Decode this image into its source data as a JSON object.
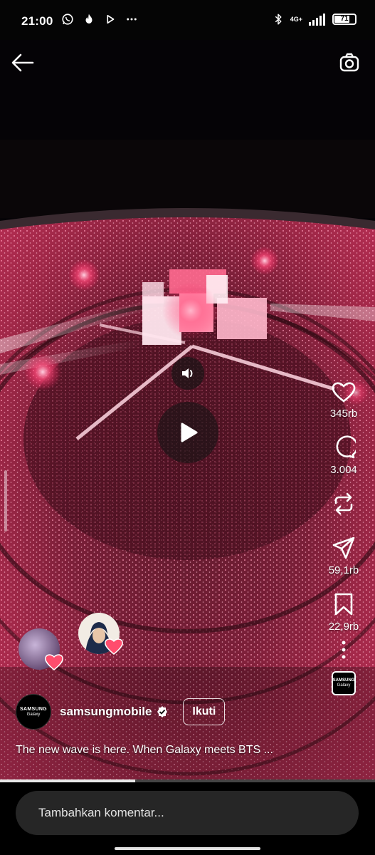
{
  "status_bar": {
    "time": "21:00",
    "network": "4G+",
    "battery": "71",
    "icons": [
      "whatsapp-icon",
      "tinder-icon",
      "play-icon",
      "more-dots-icon",
      "bluetooth-icon",
      "signal-icon",
      "battery-icon"
    ]
  },
  "video": {
    "description_icons": [
      "back-arrow-icon",
      "camera-icon",
      "speaker-icon",
      "play-icon"
    ],
    "progress": 0.36
  },
  "actions": {
    "like_count": "345rb",
    "comment_count": "3.004",
    "share_count": "59,1rb",
    "save_count": "22,9rb"
  },
  "audio": {
    "line1": "SAMSUNG",
    "line2": "Galaxy"
  },
  "account": {
    "avatar_line1": "SAMSUNG",
    "avatar_line2": "Galaxy",
    "username": "samsungmobile",
    "follow_label": "Ikuti"
  },
  "caption": "The new wave is here. When Galaxy meets BTS ...",
  "comment": {
    "placeholder": "Tambahkan komentar..."
  },
  "colors": {
    "accent": "#ff3a6e",
    "input_bg": "#262626",
    "heart": "#ff4d6d"
  }
}
